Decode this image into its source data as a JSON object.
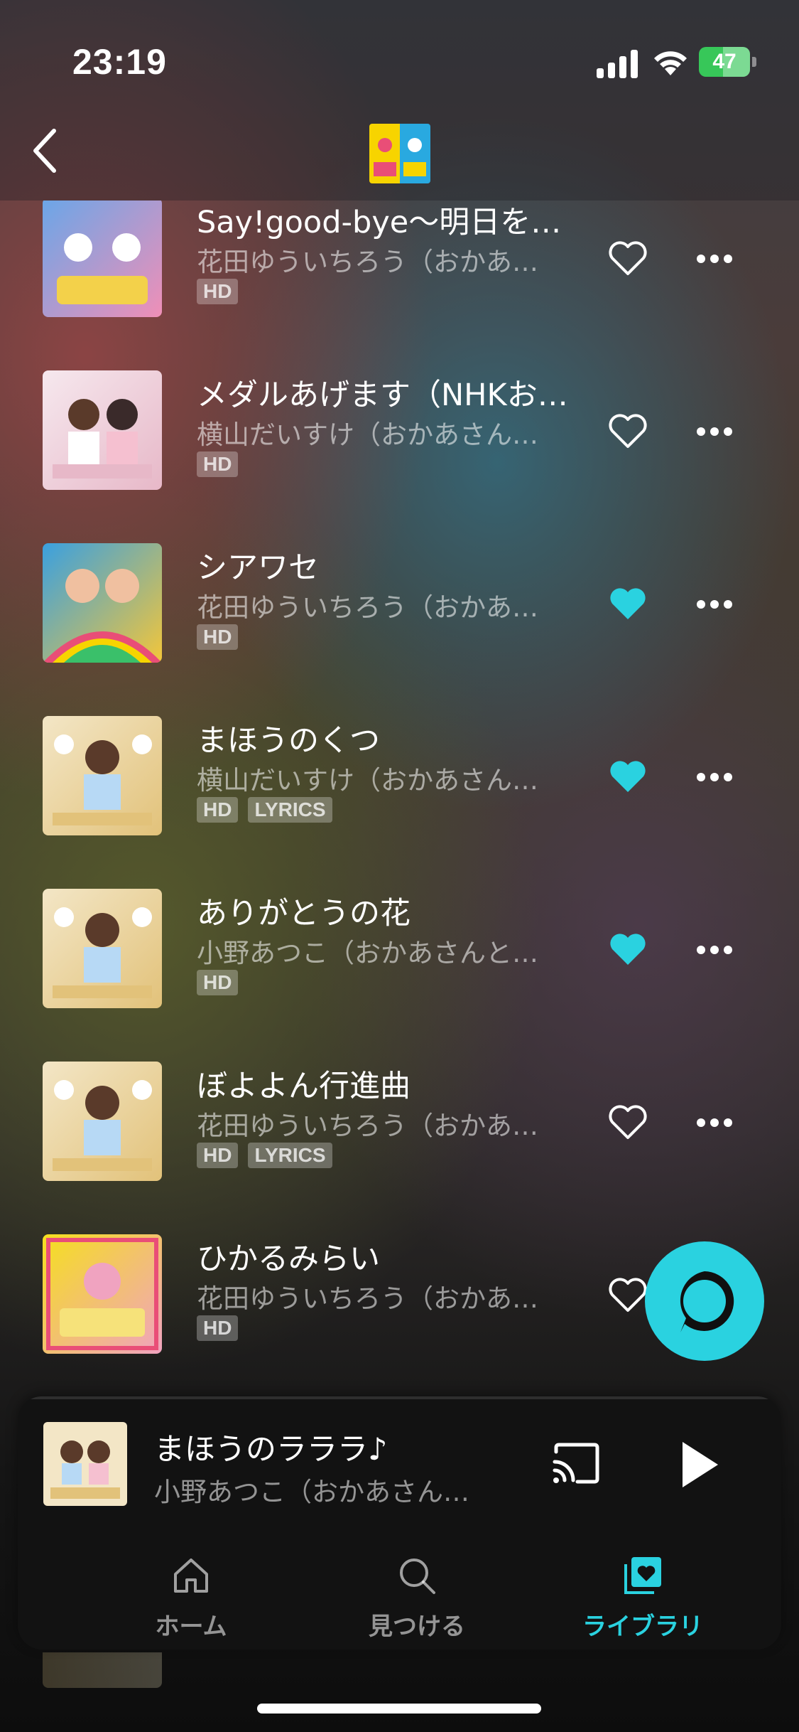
{
  "status_bar": {
    "time": "23:19",
    "battery_percent": "47"
  },
  "header": {
    "back_label": "戻る",
    "album_art_icon": "album-art-icon"
  },
  "tracks": [
    {
      "title": "Say!good-bye〜明日を…",
      "artist": "花田ゆういちろう（おかあ…",
      "badges": [
        "HD"
      ],
      "liked": false,
      "art_colors": [
        "#6aa6e8",
        "#f08fb7"
      ]
    },
    {
      "title": "メダルあげます（NHKお…",
      "artist": "横山だいすけ（おかあさん…",
      "badges": [
        "HD"
      ],
      "liked": false,
      "art_colors": [
        "#f6e8ee",
        "#e7b8c8"
      ]
    },
    {
      "title": "シアワセ",
      "artist": "花田ゆういちろう（おかあ…",
      "badges": [
        "HD"
      ],
      "liked": true,
      "art_colors": [
        "#3aa0e0",
        "#f3c63a"
      ]
    },
    {
      "title": "まほうのくつ",
      "artist": "横山だいすけ（おかあさん…",
      "badges": [
        "HD",
        "LYRICS"
      ],
      "liked": true,
      "art_colors": [
        "#f3e6c6",
        "#e2c27a"
      ]
    },
    {
      "title": "ありがとうの花",
      "artist": "小野あつこ（おかあさんと…",
      "badges": [
        "HD"
      ],
      "liked": true,
      "art_colors": [
        "#f3e6c6",
        "#e2c27a"
      ]
    },
    {
      "title": "ぼよよん行進曲",
      "artist": "花田ゆういちろう（おかあ…",
      "badges": [
        "HD",
        "LYRICS"
      ],
      "liked": false,
      "art_colors": [
        "#f3e6c6",
        "#e2c27a"
      ]
    },
    {
      "title": "ひかるみらい",
      "artist": "花田ゆういちろう（おかあ…",
      "badges": [
        "HD"
      ],
      "liked": false,
      "art_colors": [
        "#f5df1e",
        "#f0a3c0"
      ]
    }
  ],
  "now_playing": {
    "title": "まほうのラララ♪",
    "artist": "小野あつこ（おかあさん…",
    "progress": 0.0
  },
  "tabs": [
    {
      "label": "ホーム",
      "icon": "home-icon",
      "active": false
    },
    {
      "label": "見つける",
      "icon": "search-icon",
      "active": false
    },
    {
      "label": "ライブラリ",
      "icon": "library-icon",
      "active": true
    }
  ],
  "colors": {
    "accent": "#2ad2e0",
    "battery": "#37c759"
  }
}
